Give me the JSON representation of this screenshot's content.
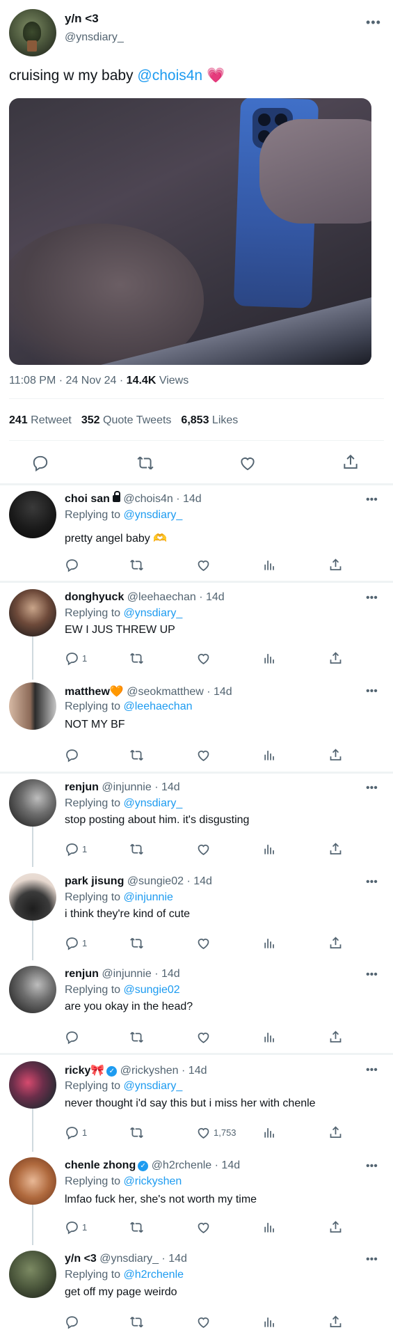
{
  "tweet": {
    "display_name": "y/n <3",
    "handle": "@ynsdiary_",
    "text_prefix": "cruising w my baby ",
    "mention": "@chois4n",
    "emoji": "💗",
    "time": "11:08 PM · 24 Nov 24 · ",
    "views_count": "14.4K",
    "views_label": " Views",
    "retweets_count": "241",
    "retweets_label": " Retweet",
    "quotes_count": "352",
    "quotes_label": " Quote Tweets",
    "likes_count": "6,853",
    "likes_label": " Likes",
    "more": "•••"
  },
  "replies": [
    {
      "name": "choi san",
      "handle": "@chois4n · 14d",
      "replying_label": "Replying to ",
      "replying_to": "@ynsdiary_",
      "text": "pretty angel baby 🫶",
      "replies_count": "",
      "likes_count": "",
      "more": "•••"
    },
    {
      "name": "donghyuck",
      "handle": "@leehaechan · 14d",
      "replying_label": "Replying to ",
      "replying_to": "@ynsdiary_",
      "text": "EW I JUS THREW UP",
      "replies_count": "1",
      "likes_count": "",
      "more": "•••"
    },
    {
      "name": "matthew",
      "name_emoji": "🧡",
      "handle": "@seokmatthew · 14d",
      "replying_label": "Replying to ",
      "replying_to": "@leehaechan",
      "text": "NOT MY BF",
      "replies_count": "",
      "likes_count": "",
      "more": "•••"
    },
    {
      "name": "renjun",
      "handle": "@injunnie · 14d",
      "replying_label": "Replying to ",
      "replying_to": "@ynsdiary_",
      "text": "stop posting about him. it's disgusting",
      "replies_count": "1",
      "likes_count": "",
      "more": "•••"
    },
    {
      "name": "park jisung",
      "handle": "@sungie02 · 14d",
      "replying_label": "Replying to ",
      "replying_to": "@injunnie",
      "text": "i think they're kind of cute",
      "replies_count": "1",
      "likes_count": "",
      "more": "•••"
    },
    {
      "name": "renjun",
      "handle": "@injunnie · 14d",
      "replying_label": "Replying to ",
      "replying_to": "@sungie02",
      "text": "are you okay in the head?",
      "replies_count": "",
      "likes_count": "",
      "more": "•••"
    },
    {
      "name": "ricky",
      "name_emoji": "🎀",
      "handle": "@rickyshen · 14d",
      "replying_label": "Replying to ",
      "replying_to": "@ynsdiary_",
      "text": "never thought i'd say this but i miss her with chenle",
      "replies_count": "1",
      "likes_count": "1,753",
      "more": "•••"
    },
    {
      "name": "chenle zhong",
      "handle": "@h2rchenle · 14d",
      "replying_label": "Replying to ",
      "replying_to": "@rickyshen",
      "text": "lmfao fuck her, she's not worth my time",
      "replies_count": "1",
      "likes_count": "",
      "more": "•••"
    },
    {
      "name": "y/n <3",
      "handle": "@ynsdiary_ · 14d",
      "replying_label": "Replying to ",
      "replying_to": "@h2rchenle",
      "text": "get off my page weirdo",
      "replies_count": "",
      "likes_count": "",
      "more": "•••"
    }
  ],
  "colors": {
    "link": "#1d9bf0",
    "muted": "#536471",
    "text": "#0f1419",
    "divider": "#eff3f4"
  }
}
